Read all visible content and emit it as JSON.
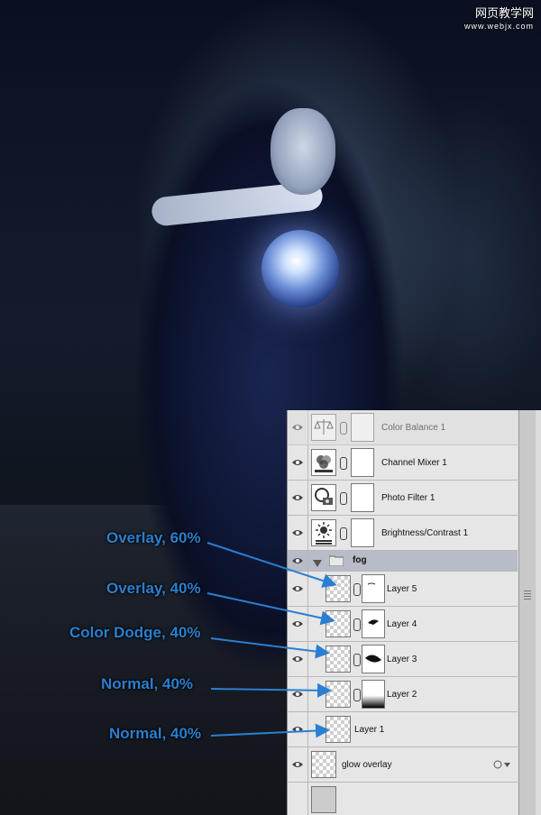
{
  "watermark": {
    "line1": "网页教学网",
    "line2": "www.webjx.com"
  },
  "layers_panel": {
    "layers": [
      {
        "name": "Color Balance 1",
        "type": "adjustment",
        "icon": "balance-scale-icon"
      },
      {
        "name": "Channel Mixer 1",
        "type": "adjustment",
        "icon": "channel-mixer-icon"
      },
      {
        "name": "Photo Filter 1",
        "type": "adjustment",
        "icon": "camera-icon"
      },
      {
        "name": "Brightness/Contrast 1",
        "type": "adjustment",
        "icon": "sun-icon"
      },
      {
        "name": "fog",
        "type": "group",
        "icon": "folder-icon"
      },
      {
        "name": "Layer 5",
        "type": "pixel_with_mask"
      },
      {
        "name": "Layer 4",
        "type": "pixel_with_mask"
      },
      {
        "name": "Layer 3",
        "type": "pixel_with_mask"
      },
      {
        "name": "Layer 2",
        "type": "pixel_with_mask"
      },
      {
        "name": "Layer 1",
        "type": "pixel"
      },
      {
        "name": "glow overlay",
        "type": "smart"
      }
    ]
  },
  "annotations": [
    {
      "text": "Overlay, 60%",
      "target": "Layer 5"
    },
    {
      "text": "Overlay, 40%",
      "target": "Layer 4"
    },
    {
      "text": "Color Dodge, 40%",
      "target": "Layer 3"
    },
    {
      "text": "Normal, 40%",
      "target": "Layer 2"
    },
    {
      "text": "Normal, 40%",
      "target": "Layer 1"
    }
  ],
  "colors": {
    "annotation": "#2a7fd0",
    "arrow": "#2a7fd0",
    "panel_bg": "#dcdcdc",
    "group_row": "#b8bcc8"
  }
}
